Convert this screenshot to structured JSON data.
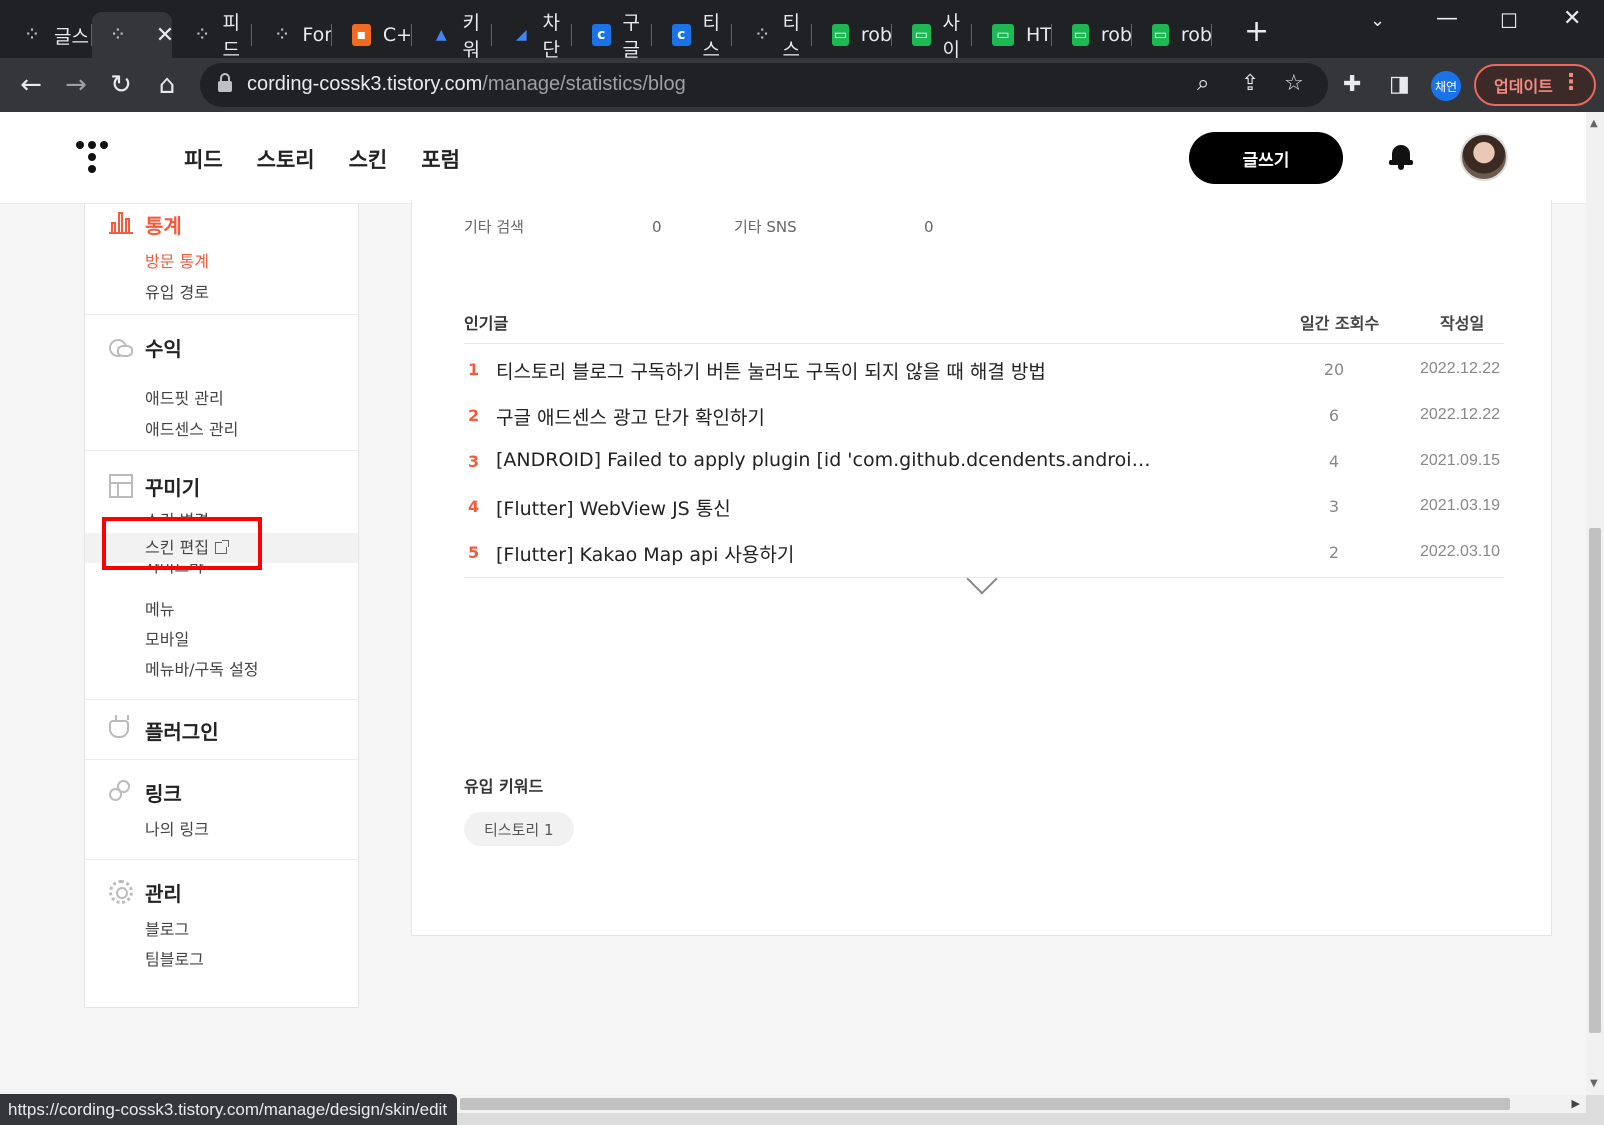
{
  "browser": {
    "tabs": [
      {
        "label": "글스",
        "favicon": "tistory-icon"
      },
      {
        "label": "",
        "favicon": "tistory-icon",
        "active": true
      },
      {
        "label": "피드",
        "favicon": "tistory-icon"
      },
      {
        "label": "For",
        "favicon": "tistory-icon"
      },
      {
        "label": "C+",
        "favicon": "orange-app-icon"
      },
      {
        "label": "키워",
        "favicon": "google-ads-icon"
      },
      {
        "label": "차단",
        "favicon": "google-ads-icon"
      },
      {
        "label": "구글",
        "favicon": "calendar-icon"
      },
      {
        "label": "티스",
        "favicon": "calendar-icon"
      },
      {
        "label": "티스",
        "favicon": "tistory-icon"
      },
      {
        "label": "rob",
        "favicon": "green-monitor-icon"
      },
      {
        "label": "사이",
        "favicon": "green-monitor-icon"
      },
      {
        "label": "HT",
        "favicon": "green-monitor-icon"
      },
      {
        "label": "rob",
        "favicon": "green-monitor-icon"
      },
      {
        "label": "rob",
        "favicon": "green-monitor-icon"
      }
    ],
    "url_host": "cording-cossk3.tistory.com",
    "url_path": "/manage/statistics/blog",
    "profile_label": "채연",
    "update_label": "업데이트",
    "status_url": "https://cording-cossk3.tistory.com/manage/design/skin/edit"
  },
  "header": {
    "nav": [
      "피드",
      "스토리",
      "스킨",
      "포럼"
    ],
    "write_label": "글쓰기"
  },
  "sidebar": {
    "groups": [
      {
        "title": "통계",
        "icon": "bar-chart-icon",
        "items": [
          "방문 통계",
          "유입 경로"
        ]
      },
      {
        "title": "수익",
        "icon": "coins-icon",
        "items": [
          "애드핏 관리",
          "애드센스 관리"
        ]
      },
      {
        "title": "꾸미기",
        "icon": "layout-icon",
        "items": [
          "스킨 변경",
          "스킨 편집",
          "사이드바",
          "메뉴",
          "모바일",
          "메뉴바/구독 설정"
        ]
      },
      {
        "title": "플러그인",
        "icon": "plugin-icon",
        "items": []
      },
      {
        "title": "링크",
        "icon": "link-icon",
        "items": [
          "나의 링크"
        ]
      },
      {
        "title": "관리",
        "icon": "gear-icon",
        "items": [
          "블로그",
          "팀블로그"
        ]
      }
    ]
  },
  "stats": {
    "other_search_label": "기타 검색",
    "other_search_value": "0",
    "other_sns_label": "기타 SNS",
    "other_sns_value": "0"
  },
  "popular": {
    "title": "인기글",
    "col_views": "일간 조회수",
    "col_date": "작성일",
    "posts": [
      {
        "rank": "1",
        "title": "티스토리 블로그 구독하기 버튼 눌러도 구독이 되지 않을 때 해결 방법",
        "views": "20",
        "date": "2022.12.22"
      },
      {
        "rank": "2",
        "title": "구글 애드센스 광고 단가 확인하기",
        "views": "6",
        "date": "2022.12.22"
      },
      {
        "rank": "3",
        "title": "[ANDROID] Failed to apply plugin [id 'com.github.dcendents.android-maven']",
        "views": "4",
        "date": "2021.09.15"
      },
      {
        "rank": "4",
        "title": "[Flutter] WebView JS 통신",
        "views": "3",
        "date": "2021.03.19"
      },
      {
        "rank": "5",
        "title": "[Flutter] Kakao Map api 사용하기",
        "views": "2",
        "date": "2022.03.10"
      }
    ]
  },
  "keywords": {
    "title": "유입 키워드",
    "items": [
      "티스토리 1"
    ]
  },
  "colors": {
    "accent": "#f25c3d",
    "highlight": "#ff0000"
  }
}
